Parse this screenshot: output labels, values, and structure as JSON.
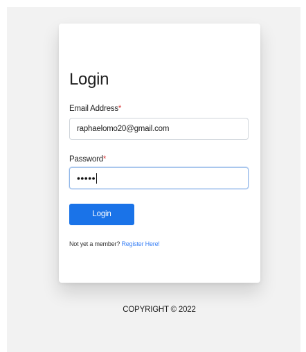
{
  "login": {
    "title": "Login",
    "email": {
      "label": "Email Address",
      "required_mark": "*",
      "value": "raphaelomo20@gmail.com"
    },
    "password": {
      "label": "Password",
      "required_mark": "*",
      "masked_value": "•••••"
    },
    "submit_label": "Login",
    "register_prompt": "Not yet a member?",
    "register_link": "Register Here!"
  },
  "footer": {
    "copyright": "COPYRIGHT © 2022"
  },
  "colors": {
    "primary": "#1a73e8",
    "link": "#3b82f6",
    "required": "#d93a3a",
    "background": "#f2f2f2"
  }
}
